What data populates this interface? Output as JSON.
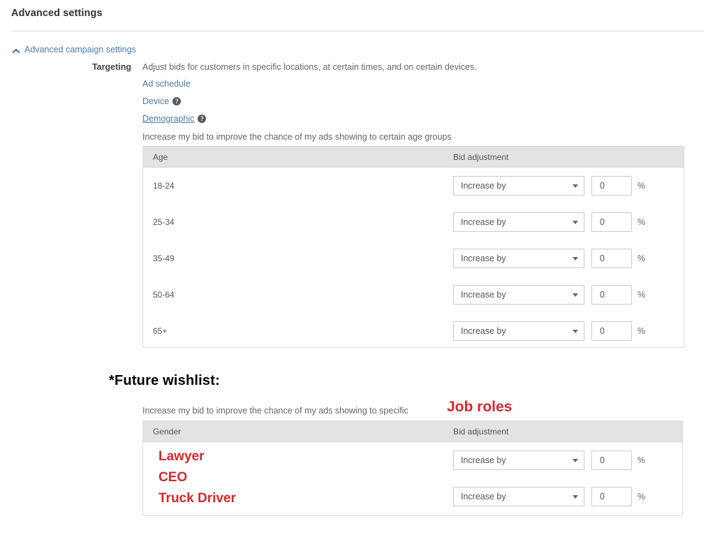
{
  "page": {
    "title": "Advanced settings"
  },
  "section": {
    "toggle_label": "Advanced campaign settings",
    "chevron_icon": "chevron-up-icon"
  },
  "targeting": {
    "label": "Targeting",
    "description": "Adjust bids for customers in specific locations, at certain times, and on certain devices.",
    "links": [
      {
        "label": "Ad schedule",
        "has_help": false,
        "active": false
      },
      {
        "label": "Device",
        "has_help": true,
        "active": false
      },
      {
        "label": "Demographic",
        "has_help": true,
        "active": true
      }
    ],
    "help_icon": "help-question-icon",
    "help_glyph": "?"
  },
  "age_section": {
    "intro": "Increase my bid to improve the chance of my ads showing to certain age groups",
    "columns": [
      "Age",
      "Bid adjustment"
    ],
    "rows": [
      {
        "group": "18-24",
        "adjustment_type": "Increase by",
        "amount": "0",
        "unit": "%"
      },
      {
        "group": "25-34",
        "adjustment_type": "Increase by",
        "amount": "0",
        "unit": "%"
      },
      {
        "group": "35-49",
        "adjustment_type": "Increase by",
        "amount": "0",
        "unit": "%"
      },
      {
        "group": "50-64",
        "adjustment_type": "Increase by",
        "amount": "0",
        "unit": "%"
      },
      {
        "group": "65+",
        "adjustment_type": "Increase by",
        "amount": "0",
        "unit": "%"
      }
    ]
  },
  "gender_section": {
    "intro": "Increase my bid to improve the chance of my ads showing to specific",
    "columns": [
      "Gender",
      "Bid adjustment"
    ],
    "rows": [
      {
        "group": "",
        "adjustment_type": "Increase by",
        "amount": "0",
        "unit": "%"
      },
      {
        "group": "",
        "adjustment_type": "Increase by",
        "amount": "0",
        "unit": "%"
      }
    ]
  },
  "annotations": {
    "color": "#d8282a",
    "wishlist_heading": "*Future wishlist:",
    "job_roles": "Job roles",
    "roles": [
      "Lawyer",
      "CEO",
      "Truck Driver"
    ]
  }
}
